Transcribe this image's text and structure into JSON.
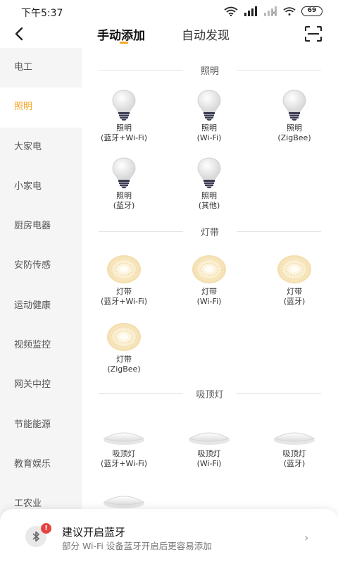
{
  "status_bar": {
    "time": "下午5:37",
    "battery": "69"
  },
  "header": {
    "tabs": [
      {
        "label": "手动添加",
        "active": true
      },
      {
        "label": "自动发现",
        "active": false
      }
    ]
  },
  "sidebar": {
    "items": [
      {
        "label": "电工"
      },
      {
        "label": "照明",
        "active": true
      },
      {
        "label": "大家电"
      },
      {
        "label": "小家电"
      },
      {
        "label": "厨房电器"
      },
      {
        "label": "安防传感"
      },
      {
        "label": "运动健康"
      },
      {
        "label": "视频监控"
      },
      {
        "label": "网关中控"
      },
      {
        "label": "节能能源"
      },
      {
        "label": "教育娱乐"
      },
      {
        "label": "工农业"
      }
    ]
  },
  "sections": [
    {
      "title": "照明",
      "icon": "bulb-icon",
      "devices": [
        {
          "name": "照明",
          "sub": "(蓝牙+Wi-Fi)"
        },
        {
          "name": "照明",
          "sub": "(Wi-Fi)"
        },
        {
          "name": "照明",
          "sub": "(ZigBee)"
        },
        {
          "name": "照明",
          "sub": "(蓝牙)"
        },
        {
          "name": "照明",
          "sub": "(其他)"
        }
      ]
    },
    {
      "title": "灯带",
      "icon": "light-strip-icon",
      "devices": [
        {
          "name": "灯带",
          "sub": "(蓝牙+Wi-Fi)"
        },
        {
          "name": "灯带",
          "sub": "(Wi-Fi)"
        },
        {
          "name": "灯带",
          "sub": "(蓝牙)"
        },
        {
          "name": "灯带",
          "sub": "(ZigBee)"
        }
      ]
    },
    {
      "title": "吸顶灯",
      "icon": "ceiling-light-icon",
      "devices": [
        {
          "name": "吸顶灯",
          "sub": "(蓝牙+Wi-Fi)"
        },
        {
          "name": "吸顶灯",
          "sub": "(Wi-Fi)"
        },
        {
          "name": "吸顶灯",
          "sub": "(蓝牙)"
        },
        {
          "name": "吸顶灯",
          "sub": ""
        }
      ]
    }
  ],
  "bluetooth_tip": {
    "badge": "!",
    "title": "建议开启蓝牙",
    "subtitle": "部分 Wi-Fi 设备蓝牙开启后更容易添加",
    "chevron": "›"
  },
  "colors": {
    "accent": "#f5a623",
    "sidebar_bg": "#f5f5f5",
    "badge": "#e64340"
  }
}
